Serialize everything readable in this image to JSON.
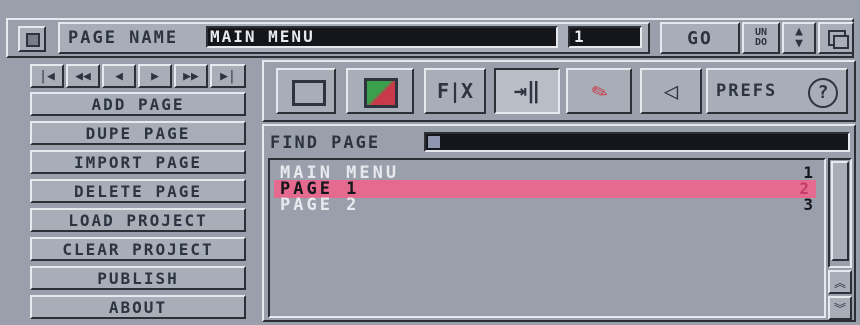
{
  "top_bar": {
    "page_name_label": "PAGE NAME",
    "page_name_value": "MAIN MENU",
    "page_number_value": "1",
    "go_label": "GO",
    "undo_label": "UN DO"
  },
  "nav_arrows": [
    "first",
    "prev-fast",
    "prev",
    "next",
    "next-fast",
    "last"
  ],
  "sidebar": {
    "items": [
      {
        "label": "ADD PAGE"
      },
      {
        "label": "DUPE PAGE"
      },
      {
        "label": "IMPORT PAGE"
      },
      {
        "label": "DELETE PAGE"
      },
      {
        "label": "LOAD PROJECT"
      },
      {
        "label": "CLEAR PROJECT"
      },
      {
        "label": "PUBLISH"
      },
      {
        "label": "ABOUT"
      }
    ]
  },
  "toolbar": {
    "icons": [
      "frame-icon",
      "gradient-icon",
      "fx-icon",
      "link-icon",
      "paint-icon",
      "sound-icon"
    ],
    "fx_label": "F|X",
    "prefs_label": "PREFS"
  },
  "find": {
    "label": "FIND PAGE"
  },
  "pages": [
    {
      "name": "MAIN MENU",
      "number": "1"
    },
    {
      "name": "PAGE 1",
      "number": "2",
      "selected": true
    },
    {
      "name": "PAGE 2",
      "number": "3"
    }
  ],
  "colors": {
    "background": "#9aa0ab",
    "field_dark": "#15161c",
    "selection": "#e46b8f",
    "text_dark": "#2d3440",
    "text_light": "#e7e9ee"
  }
}
